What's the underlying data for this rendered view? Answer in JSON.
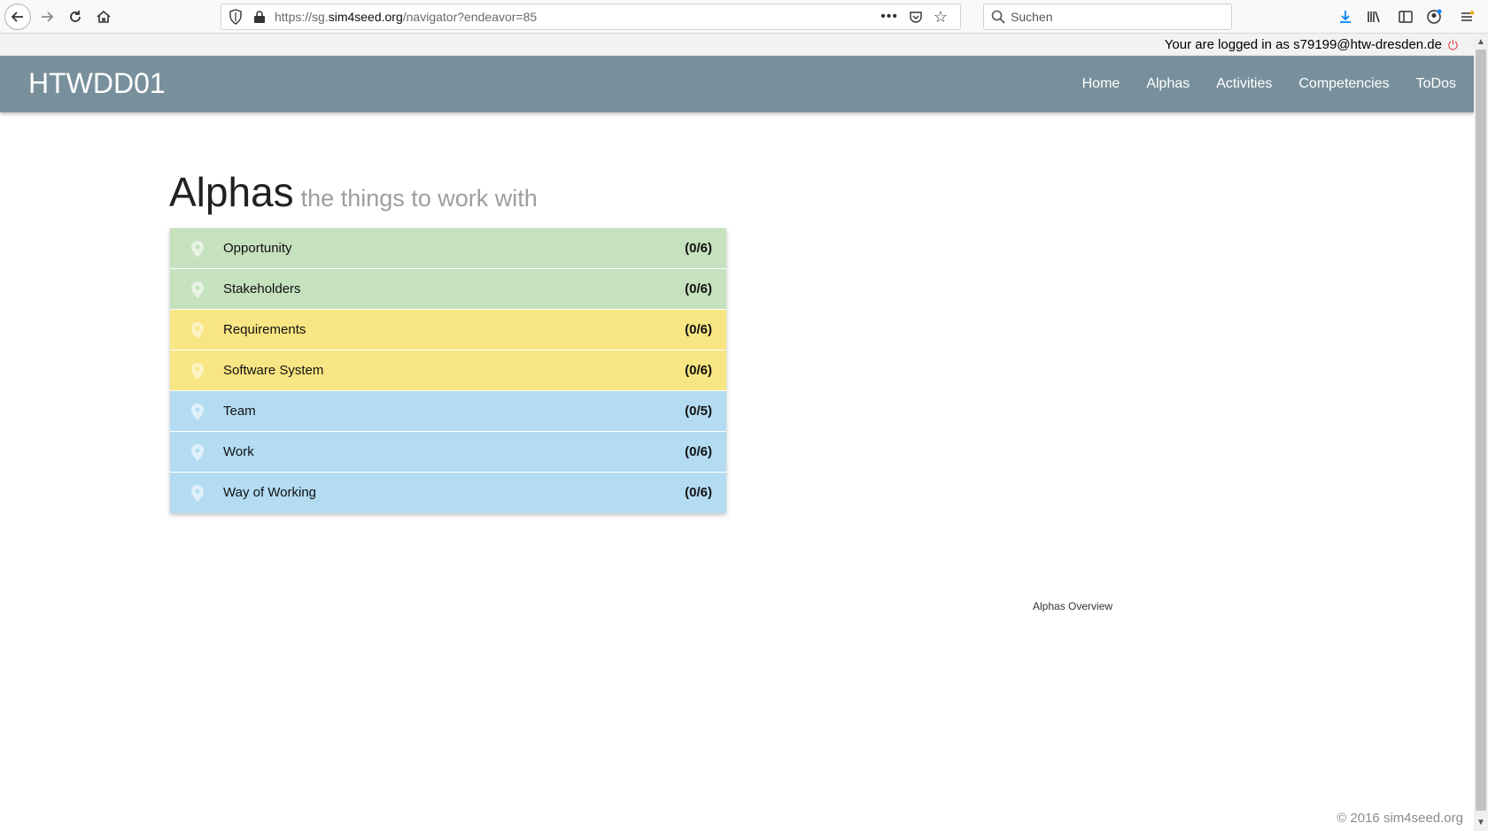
{
  "browser": {
    "url_prefix": "https://sg.",
    "url_domain": "sim4seed.org",
    "url_path": "/navigator?endeavor=85",
    "search_placeholder": "Suchen",
    "meatball": "•••"
  },
  "login": {
    "text": "Your are logged in as s79199@htw-dresden.de"
  },
  "header": {
    "brand": "HTWDD01",
    "nav": [
      "Home",
      "Alphas",
      "Activities",
      "Competencies",
      "ToDos"
    ]
  },
  "page": {
    "title": "Alphas",
    "subtitle": "the things to work with"
  },
  "alphas": [
    {
      "name": "Opportunity",
      "count": "(0/6)",
      "area": "green"
    },
    {
      "name": "Stakeholders",
      "count": "(0/6)",
      "area": "green"
    },
    {
      "name": "Requirements",
      "count": "(0/6)",
      "area": "yellow"
    },
    {
      "name": "Software System",
      "count": "(0/6)",
      "area": "yellow"
    },
    {
      "name": "Team",
      "count": "(0/5)",
      "area": "blue"
    },
    {
      "name": "Work",
      "count": "(0/6)",
      "area": "blue"
    },
    {
      "name": "Way of Working",
      "count": "(0/6)",
      "area": "blue"
    }
  ],
  "colors": {
    "header_bg": "#78909c",
    "customer_area": "#c5e1bd",
    "solution_area": "#f8e583",
    "endeavor_area": "#b3dbf2"
  },
  "overview_caption": "Alphas Overview",
  "footer": {
    "copyright": "© 2016 sim4seed.org"
  }
}
